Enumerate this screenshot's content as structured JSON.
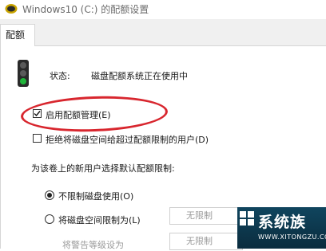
{
  "window": {
    "title": "Windows10 (C:) 的配额设置"
  },
  "tabs": [
    {
      "label": "配额"
    }
  ],
  "status": {
    "label": "状态:",
    "value": "磁盘配额系统正在使用中"
  },
  "options": {
    "enable_quota": {
      "label": "启用配额管理(E)",
      "checked": true
    },
    "deny_space": {
      "label": "拒绝将磁盘空间给超过配额限制的用户(D)",
      "checked": false
    }
  },
  "defaults": {
    "heading": "为该卷上的新用户选择默认配额限制:",
    "no_limit": {
      "label": "不限制磁盘使用(O)",
      "selected": true
    },
    "limit_space": {
      "label": "将磁盘空间限制为(L)",
      "selected": false,
      "value": "无限制"
    },
    "warning_level": {
      "label": "将警告等级设为",
      "value": "无限制"
    }
  },
  "watermark": {
    "name": "系统族",
    "url": "WWW.XITONGZU.COM"
  },
  "colors": {
    "highlight": "#d8262e",
    "watermark_bg": "#10455e"
  }
}
